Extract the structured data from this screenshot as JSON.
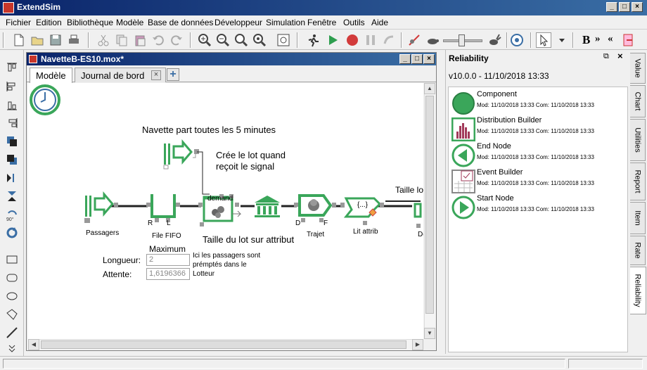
{
  "app": {
    "title": "ExtendSim"
  },
  "menu": [
    "Fichier",
    "Edition",
    "Bibliothèque",
    "Modèle",
    "Base de données",
    "Développeur",
    "Simulation",
    "Fenêtre",
    "Outils",
    "Aide"
  ],
  "model_window": {
    "title": "NavetteB-ES10.mox*",
    "tabs": [
      {
        "label": "Modèle"
      },
      {
        "label": "Journal de bord"
      }
    ]
  },
  "canvas": {
    "heading": "Navette part toutes les 5 minutes",
    "note_batch_line1": "Crée le lot quand",
    "note_batch_line2": "reçoit le signal",
    "note_batch_size": "Taille du lot sur attribut",
    "label_top_right": "Taille lot",
    "blocks": {
      "passagers": "Passagers",
      "file_fifo": "File FIFO",
      "trajet": "Trajet",
      "lit_attrib": "Lit attrib",
      "de": "Dé",
      "demand": "demand",
      "set_label": "{...}"
    },
    "port_letters": {
      "r": "R",
      "l": "L",
      "d": "D",
      "f": "F"
    },
    "maximum_label": "Maximum",
    "longueur_label": "Longueur:",
    "longueur_value": "2",
    "attente_label": "Attente:",
    "attente_value": "1,6196366",
    "preempt_line1": "Ici les passagers sont",
    "preempt_line2": "prémptés dans le",
    "preempt_line3": "Lotteur"
  },
  "reliability": {
    "title": "Reliability",
    "version": "v10.0.0  -  11/10/2018 13:33",
    "items": [
      {
        "name": "Component",
        "meta": "Mod:  11/10/2018 13:33   Com:  11/10/2018 13:33",
        "icon": "component-icon"
      },
      {
        "name": "Distribution Builder",
        "meta": "Mod:  11/10/2018 13:33   Com:  11/10/2018 13:33",
        "icon": "distribution-builder-icon"
      },
      {
        "name": "End Node",
        "meta": "Mod:  11/10/2018 13:33   Com:  11/10/2018 13:33",
        "icon": "end-node-icon"
      },
      {
        "name": "Event Builder",
        "meta": "Mod:  11/10/2018 13:33   Com:  11/10/2018 13:33",
        "icon": "event-builder-icon"
      },
      {
        "name": "Start Node",
        "meta": "Mod:  11/10/2018 13:33   Com:  11/10/2018 13:33",
        "icon": "start-node-icon"
      }
    ]
  },
  "side_tabs": [
    "Value",
    "Chart",
    "Utilities",
    "Report",
    "Item",
    "Rate",
    "Reliability"
  ],
  "toolbar": {
    "bold": "B",
    "left_arrows": "«",
    "right_arrows": "»"
  },
  "colors": {
    "block_green": "#3aa65a",
    "light_green": "#7ec77f",
    "title_blue": "#0a246a",
    "play_green": "#2e9e4f",
    "stop_red": "#d23b3b"
  }
}
